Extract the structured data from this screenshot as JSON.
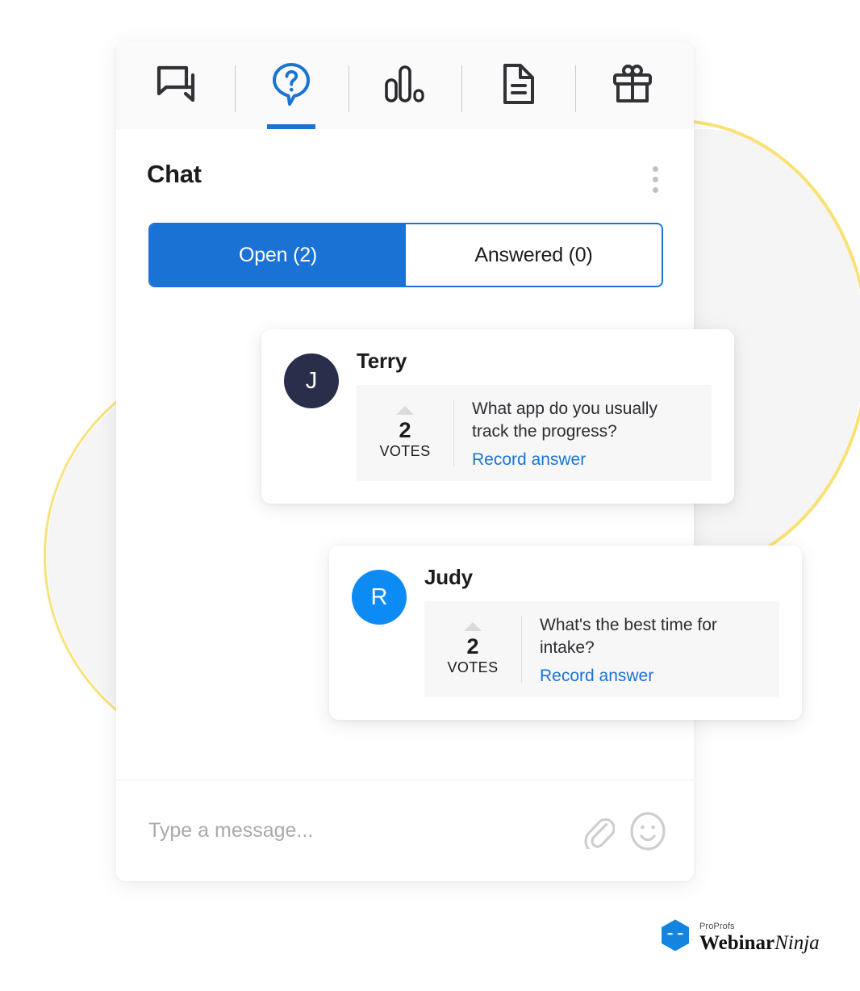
{
  "toolbar": {
    "tabs": [
      {
        "name": "chat",
        "icon": "chat-bubbles-icon",
        "active": false
      },
      {
        "name": "qa",
        "icon": "question-bubble-icon",
        "active": true
      },
      {
        "name": "polls",
        "icon": "poll-bars-icon",
        "active": false
      },
      {
        "name": "handouts",
        "icon": "document-icon",
        "active": false
      },
      {
        "name": "offers",
        "icon": "gift-icon",
        "active": false
      }
    ]
  },
  "header": {
    "title": "Chat",
    "menu_icon": "kebab-menu-icon"
  },
  "segmented": {
    "open_label": "Open (2)",
    "answered_label": "Answered (0)",
    "active": "open"
  },
  "questions": [
    {
      "avatar_letter": "J",
      "avatar_color": "#2b2e4b",
      "name": "Terry",
      "votes": "2",
      "votes_label": "VOTES",
      "text": "What app do you usually track the progress?",
      "action_label": "Record answer"
    },
    {
      "avatar_letter": "R",
      "avatar_color": "#0d8bf5",
      "name": "Judy",
      "votes": "2",
      "votes_label": "VOTES",
      "text": "What's the best time for intake?",
      "action_label": "Record answer"
    }
  ],
  "composer": {
    "placeholder": "Type a message...",
    "value": "",
    "attach_icon": "paperclip-icon",
    "emoji_icon": "smiley-icon"
  },
  "brand": {
    "small": "ProProfs",
    "name_bold": "Webinar",
    "name_italic": "Ninja",
    "logo_icon": "webinarninja-hexagon-logo"
  },
  "colors": {
    "accent_blue": "#1a73d4",
    "link_blue": "#1a73d4",
    "avatar_blue": "#0d8bf5",
    "avatar_navy": "#2b2e4b",
    "deco_yellow": "#fae173",
    "deco_gray": "#f5f5f6"
  }
}
